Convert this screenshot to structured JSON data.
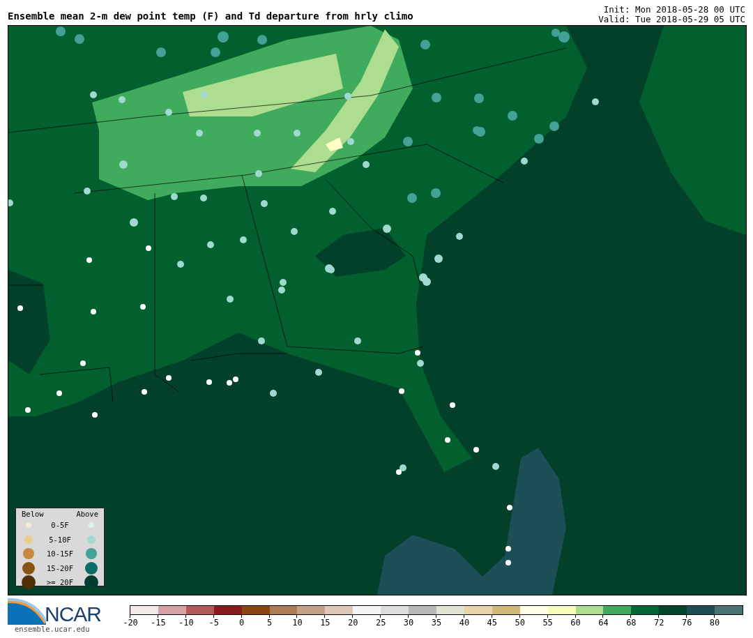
{
  "title": "Ensemble mean 2-m dew point temp (F) and Td departure from hrly climo",
  "init": "Init: Mon 2018-05-28 00 UTC",
  "valid": "Valid: Tue 2018-05-29 05 UTC",
  "legend": {
    "below_heading": "Below",
    "above_heading": "Above",
    "rows": [
      {
        "label": "0-5F",
        "below": {
          "color": "#f6ecd6"
        },
        "above": {
          "color": "#dff1ef"
        }
      },
      {
        "label": "5-10F",
        "below": {
          "color": "#e9cd8f"
        },
        "above": {
          "color": "#9fd9d0"
        }
      },
      {
        "label": "10-15F",
        "below": {
          "color": "#c68a3e"
        },
        "above": {
          "color": "#43a196"
        }
      },
      {
        "label": "15-20F",
        "below": {
          "color": "#8b5313"
        },
        "above": {
          "color": "#0a6c62"
        }
      },
      {
        "label": ">= 20F",
        "below": {
          "color": "#522e05"
        },
        "above": {
          "color": "#013c30"
        }
      }
    ]
  },
  "logo": {
    "text": "NCAR",
    "url": "ensemble.ucar.edu"
  },
  "colorbar": {
    "segments": [
      {
        "color": "#f5e8e8"
      },
      {
        "color": "#d5a1a5"
      },
      {
        "color": "#b25a5b"
      },
      {
        "color": "#8b1a1c"
      },
      {
        "color": "#8b4513"
      },
      {
        "color": "#ad7b56"
      },
      {
        "color": "#c7a088"
      },
      {
        "color": "#e0c8b8"
      },
      {
        "color": "#f3f3f3"
      },
      {
        "color": "#dcdcdc"
      },
      {
        "color": "#b9b9b9"
      },
      {
        "color": "#e3e3d3"
      },
      {
        "color": "#e5d5a8"
      },
      {
        "color": "#d0b877"
      },
      {
        "color": "#ffffe5"
      },
      {
        "color": "#f7fcb9"
      },
      {
        "color": "#addd8e"
      },
      {
        "color": "#41ab5d"
      },
      {
        "color": "#006837"
      },
      {
        "color": "#004529"
      },
      {
        "color": "#1d4f57"
      },
      {
        "color": "#4a7375"
      }
    ],
    "ticks": [
      "-20",
      "-15",
      "-10",
      "-5",
      "0",
      "5",
      "10",
      "15",
      "20",
      "25",
      "30",
      "35",
      "40",
      "45",
      "50",
      "55",
      "60",
      "64",
      "68",
      "72",
      "76",
      "80"
    ]
  }
}
